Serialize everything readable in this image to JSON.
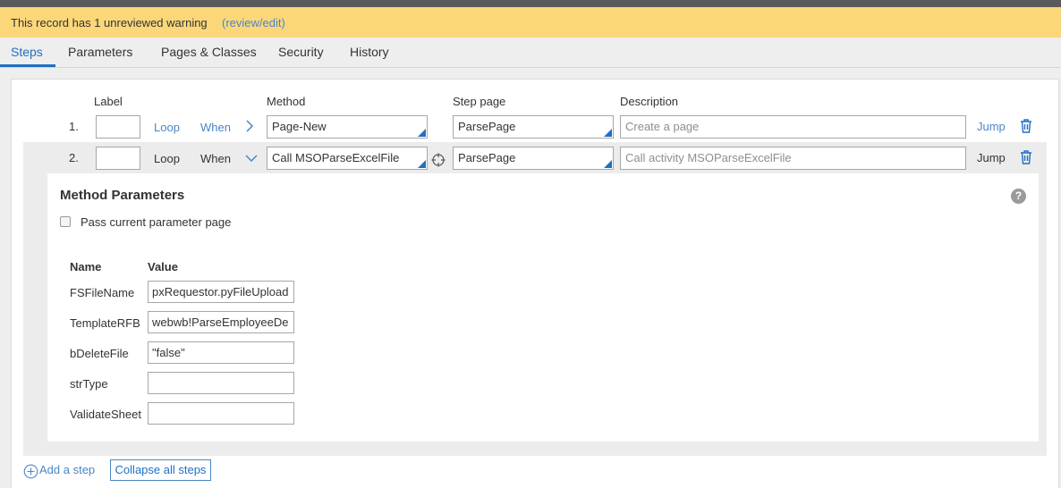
{
  "warning": {
    "text": "This record has 1 unreviewed warning",
    "link": "(review/edit)"
  },
  "tabs": [
    {
      "label": "Steps",
      "active": true
    },
    {
      "label": "Parameters"
    },
    {
      "label": "Pages & Classes"
    },
    {
      "label": "Security"
    },
    {
      "label": "History"
    }
  ],
  "columns": {
    "label": "Label",
    "method": "Method",
    "step_page": "Step page",
    "description": "Description"
  },
  "steps": [
    {
      "number": "1.",
      "label_value": "",
      "loop": "Loop",
      "when": "When",
      "method": "Page-New",
      "step_page": "ParsePage",
      "description_placeholder": "Create a page",
      "jump": "Jump",
      "expanded": false
    },
    {
      "number": "2.",
      "label_value": "",
      "loop": "Loop",
      "when": "When",
      "method": "Call MSOParseExcelFile",
      "step_page": "ParsePage",
      "description_placeholder": "Call activity MSOParseExcelFile",
      "jump": "Jump",
      "expanded": true
    }
  ],
  "method_parameters": {
    "title": "Method Parameters",
    "help": "?",
    "pass_current_label": "Pass current parameter page",
    "pass_current_checked": false,
    "name_header": "Name",
    "value_header": "Value",
    "params": [
      {
        "name": "FSFileName",
        "value": "pxRequestor.pyFileUpload"
      },
      {
        "name": "TemplateRFB",
        "value": "webwb!ParseEmployeeDe"
      },
      {
        "name": "bDeleteFile",
        "value": "\"false\""
      },
      {
        "name": "strType",
        "value": ""
      },
      {
        "name": "ValidateSheet",
        "value": ""
      }
    ]
  },
  "footer": {
    "add_step": "Add a step",
    "collapse_all": "Collapse all steps"
  },
  "colors": {
    "accent": "#1f6fc5",
    "link": "#4a86c5",
    "warning_bg": "#fbd77a"
  },
  "icons": {
    "expand_row1": "chevron-right-icon",
    "expand_row2": "chevron-down-icon",
    "delete": "trash-icon",
    "target": "crosshair-icon",
    "add": "plus-circle-icon",
    "help": "help-icon"
  }
}
